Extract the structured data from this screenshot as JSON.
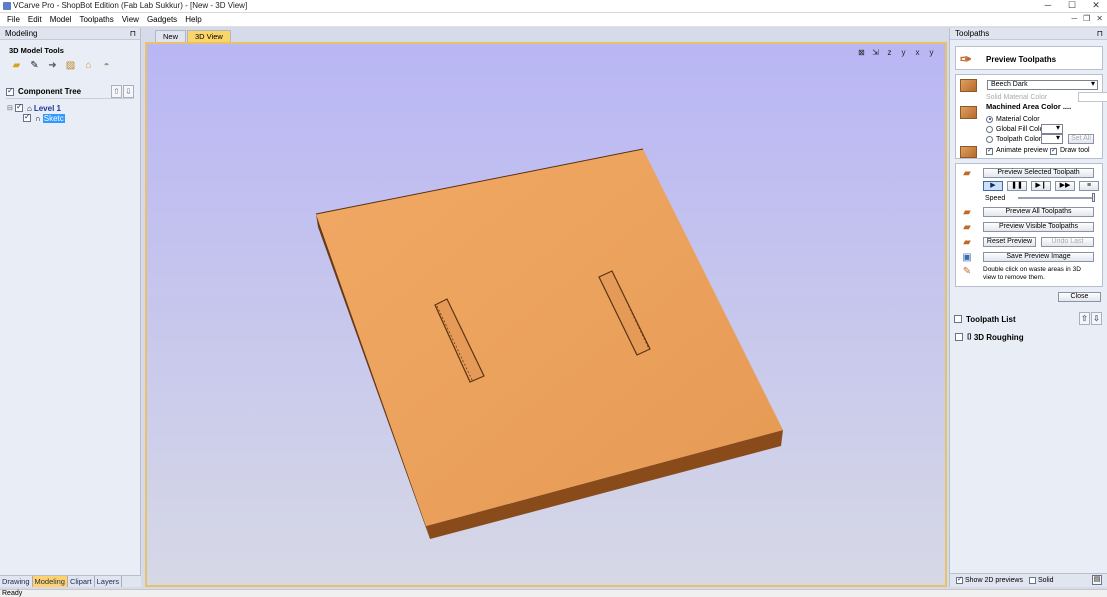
{
  "window": {
    "title": "VCarve Pro - ShopBot Edition (Fab Lab Sukkur) - [New - 3D View]"
  },
  "menu": [
    "File",
    "Edit",
    "Model",
    "Toolpaths",
    "View",
    "Gadgets",
    "Help"
  ],
  "left_panel": {
    "header": "Modeling",
    "tools_title": "3D Model Tools",
    "tools": [
      "folder-open-icon",
      "wrench-icon",
      "arrow-right-icon",
      "texture-icon",
      "lock-icon",
      "dome-icon"
    ],
    "component_tree": {
      "title": "Component Tree",
      "items": [
        {
          "label": "Level 1",
          "checked": true
        },
        {
          "label": "Sketc",
          "checked": true,
          "selected": true
        }
      ]
    },
    "bottom_tabs": [
      "Drawing",
      "Modeling",
      "Clipart",
      "Layers"
    ],
    "active_tab": "Modeling"
  },
  "center": {
    "tabs": [
      "New",
      "3D View"
    ],
    "active_tab": "3D View",
    "material_color": "#e9a15d"
  },
  "right_panel": {
    "header": "Toolpaths",
    "preview": {
      "title": "Preview Toolpaths",
      "material": "Beech Dark",
      "solid_material_color_label": "Solid Material Color",
      "machined_area_label": "Machined Area Color ....",
      "radios": [
        "Material Color",
        "Global Fill Color",
        "Toolpath Color"
      ],
      "selected_radio": "Material Color",
      "set_all": "Set All",
      "animate_preview": "Animate preview",
      "draw_tool": "Draw tool",
      "preview_selected": "Preview Selected Toolpath",
      "speed_label": "Speed",
      "speed_value": 1.0,
      "preview_all": "Preview All Toolpaths",
      "preview_visible": "Preview Visible Toolpaths",
      "reset_preview": "Reset Preview",
      "undo_last": "Undo Last",
      "save_image": "Save Preview Image",
      "hint": "Double click on waste areas in 3D view to remove them.",
      "close": "Close"
    },
    "toolpath_list": {
      "title": "Toolpath List",
      "items": [
        {
          "label": "3D Roughing",
          "checked": false
        }
      ]
    },
    "show_2d_previews": "Show 2D previews",
    "solid": "Solid"
  },
  "status": {
    "text": "Ready"
  }
}
